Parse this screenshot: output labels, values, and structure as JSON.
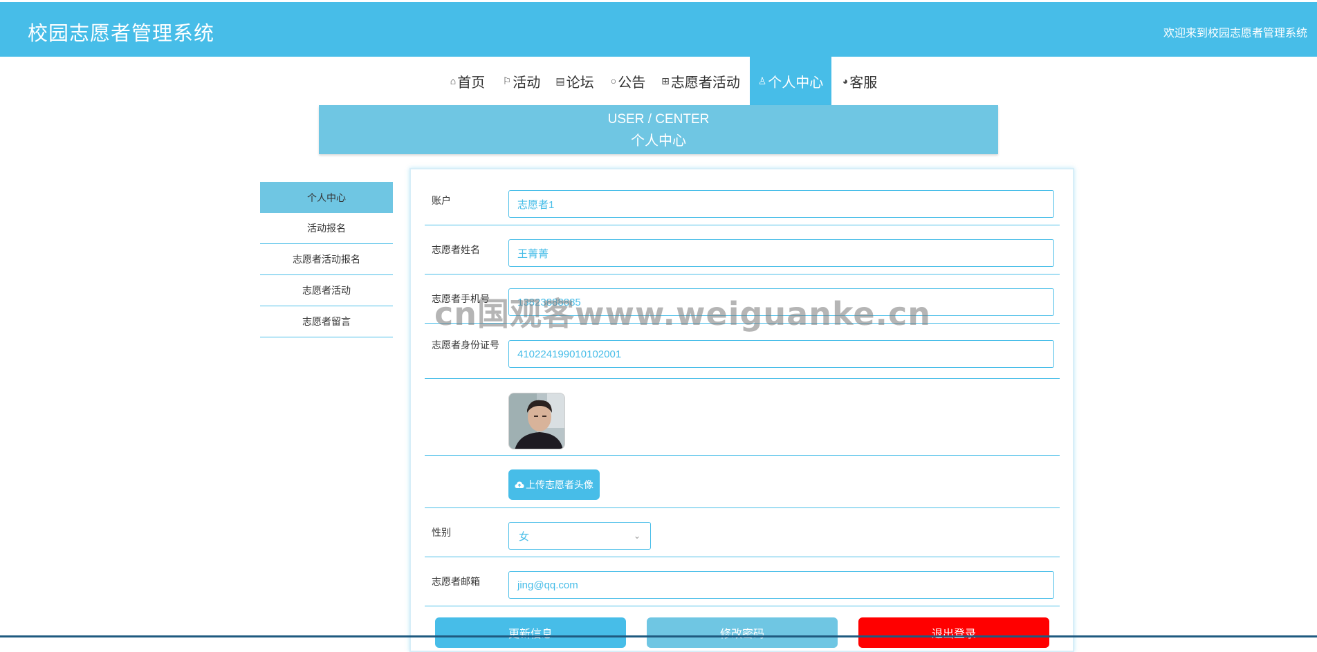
{
  "header": {
    "title": "校园志愿者管理系统",
    "welcome": "欢迎来到校园志愿者管理系统"
  },
  "nav": [
    {
      "label": "首页",
      "icon": "home-icon",
      "glyph": "⌂"
    },
    {
      "label": "活动",
      "icon": "flag-icon",
      "glyph": "⚐"
    },
    {
      "label": "论坛",
      "icon": "forum-icon",
      "glyph": "▤"
    },
    {
      "label": "公告",
      "icon": "notice-icon",
      "glyph": "○"
    },
    {
      "label": "志愿者活动",
      "icon": "grid-icon",
      "glyph": "⊞"
    },
    {
      "label": "个人中心",
      "icon": "user-icon",
      "glyph": "♙",
      "active": true
    },
    {
      "label": "客服",
      "icon": "chat-icon",
      "glyph": "◕"
    }
  ],
  "banner": {
    "en": "USER / CENTER",
    "cn": "个人中心"
  },
  "sidebar": [
    {
      "label": "个人中心",
      "active": true
    },
    {
      "label": "活动报名"
    },
    {
      "label": "志愿者活动报名"
    },
    {
      "label": "志愿者活动"
    },
    {
      "label": "志愿者留言"
    }
  ],
  "form": {
    "account_label": "账户",
    "account_value": "志愿者1",
    "name_label": "志愿者姓名",
    "name_value": "王菁菁",
    "phone_label": "志愿者手机号",
    "phone_value": "13823888885",
    "idcard_label": "志愿者身份证号",
    "idcard_value": "410224199010102001",
    "upload_label": "上传志愿者头像",
    "gender_label": "性别",
    "gender_value": "女",
    "email_label": "志愿者邮箱",
    "email_value": "jing@qq.com"
  },
  "buttons": {
    "update": "更新信息",
    "change_password": "修改密码",
    "logout": "退出登录"
  },
  "watermark": "cn国观客www.weiguanke.cn",
  "colors": {
    "primary": "#47bde8",
    "banner": "#6fc6e3",
    "logout": "#ff0000"
  }
}
